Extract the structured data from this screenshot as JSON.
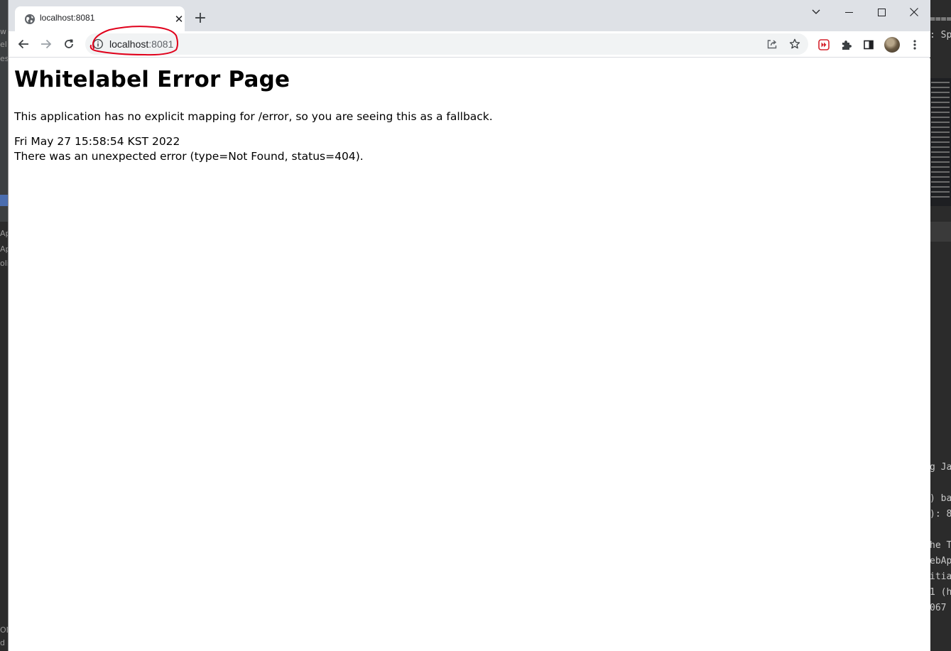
{
  "browser": {
    "tab": {
      "title": "localhost:8081"
    },
    "new_tab": "+",
    "address_bar": {
      "host": "localhost",
      "port": ":8081"
    }
  },
  "page": {
    "heading": "Whitelabel Error Page",
    "message": "This application has no explicit mapping for /error, so you are seeing this as a fallback.",
    "timestamp": "Fri May 27 15:58:54 KST 2022",
    "error": "There was an unexpected error (type=Not Found, status=404)."
  },
  "background_ide": {
    "left_fragments": [
      "w",
      "el",
      "es",
      "App",
      "Ap",
      "olic",
      "OD",
      "d"
    ],
    "right_fragments": [
      "====",
      ": Sp",
      "g Ja",
      ") bac",
      "): 8",
      "he T",
      "ebAp",
      "itia",
      "1 (h",
      "067"
    ]
  },
  "colors": {
    "annotation": "#e0001b",
    "tabstrip": "#dee1e6",
    "omnibox": "#f1f3f4"
  }
}
